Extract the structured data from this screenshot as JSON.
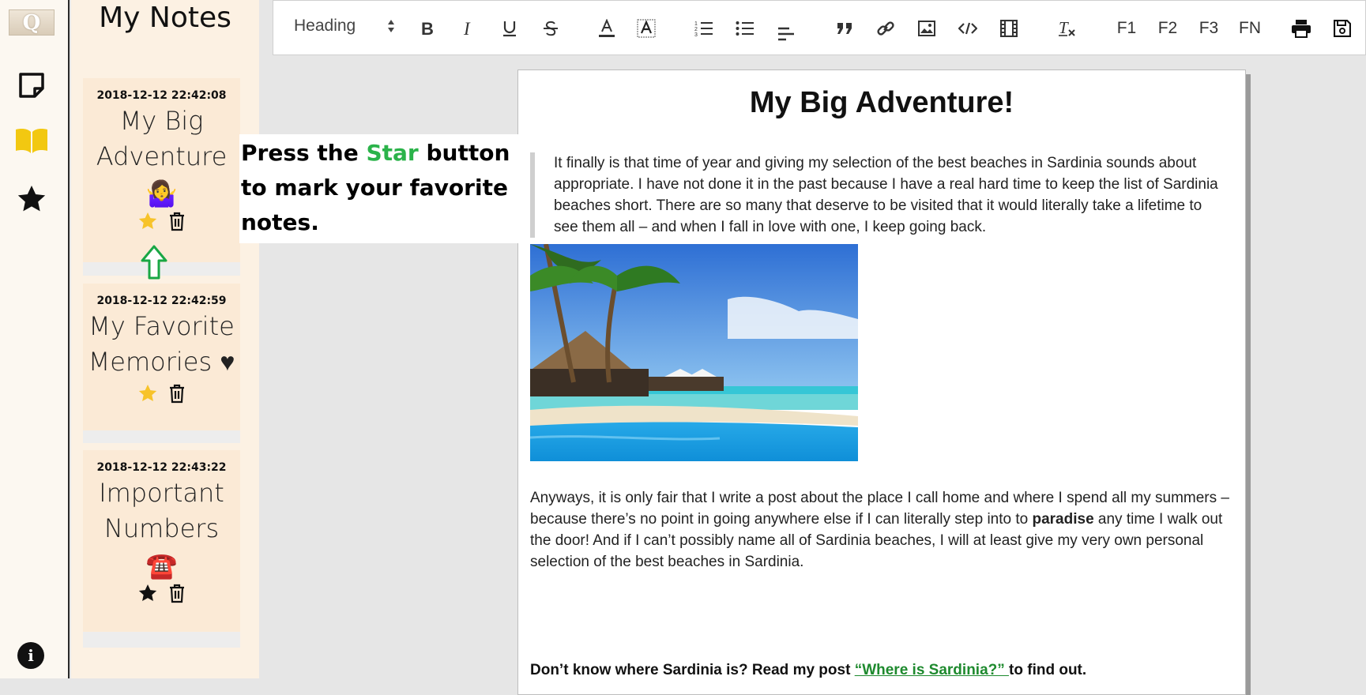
{
  "app": {
    "logo_letter": "Q"
  },
  "rail": {
    "items": [
      {
        "name": "notes",
        "icon": "sticky-note-icon"
      },
      {
        "name": "notebooks",
        "icon": "open-book-icon",
        "color": "#f2c811"
      },
      {
        "name": "favorites",
        "icon": "star-icon"
      }
    ],
    "info_label": "i"
  },
  "notes_panel": {
    "title": "My Notes",
    "cards": [
      {
        "date": "2018-12-12 22:42:08",
        "title": "My Big Adventure",
        "emoji": "🤷‍♀️",
        "starred": true
      },
      {
        "date": "2018-12-12 22:42:59",
        "title": "My Favorite Memories ♥",
        "emoji": "",
        "starred": true
      },
      {
        "date": "2018-12-12 22:43:22",
        "title": "Important Numbers",
        "emoji": "☎️",
        "starred": false
      }
    ]
  },
  "toolbar": {
    "heading_select": "Heading",
    "font_buttons": [
      "F1",
      "F2",
      "F3",
      "FN"
    ]
  },
  "document": {
    "title": "My Big Adventure!",
    "quote": "It finally is that time of year and giving my selection of the best beaches in Sardinia sounds about appropriate. I have not done it in the past because I have a real hard time to keep the list of Sardinia beaches short. There are so many that deserve to be visited that it would literally take a lifetime to see them all – and when I fall in love with one, I keep going back.",
    "para2_a": "Anyways, it is only fair that I write a post about the place I call home and where I spend all my summers – because there’s no point in going anywhere else if I can literally step into to ",
    "para2_bold": "paradise",
    "para2_b": " any time I walk out the door! And if I can’t possibly name all of Sardinia beaches, I will at least give my very own personal selection of the best beaches in Sardinia.",
    "para3_a": "Don’t know where Sardinia is? Read my post ",
    "para3_link": "“Where is Sardinia?” ",
    "para3_b": "to find out."
  },
  "callout": {
    "before": "Press the ",
    "highlight": "Star",
    "after": " button to mark your favorite notes.",
    "highlight_color": "#2bb34a"
  }
}
